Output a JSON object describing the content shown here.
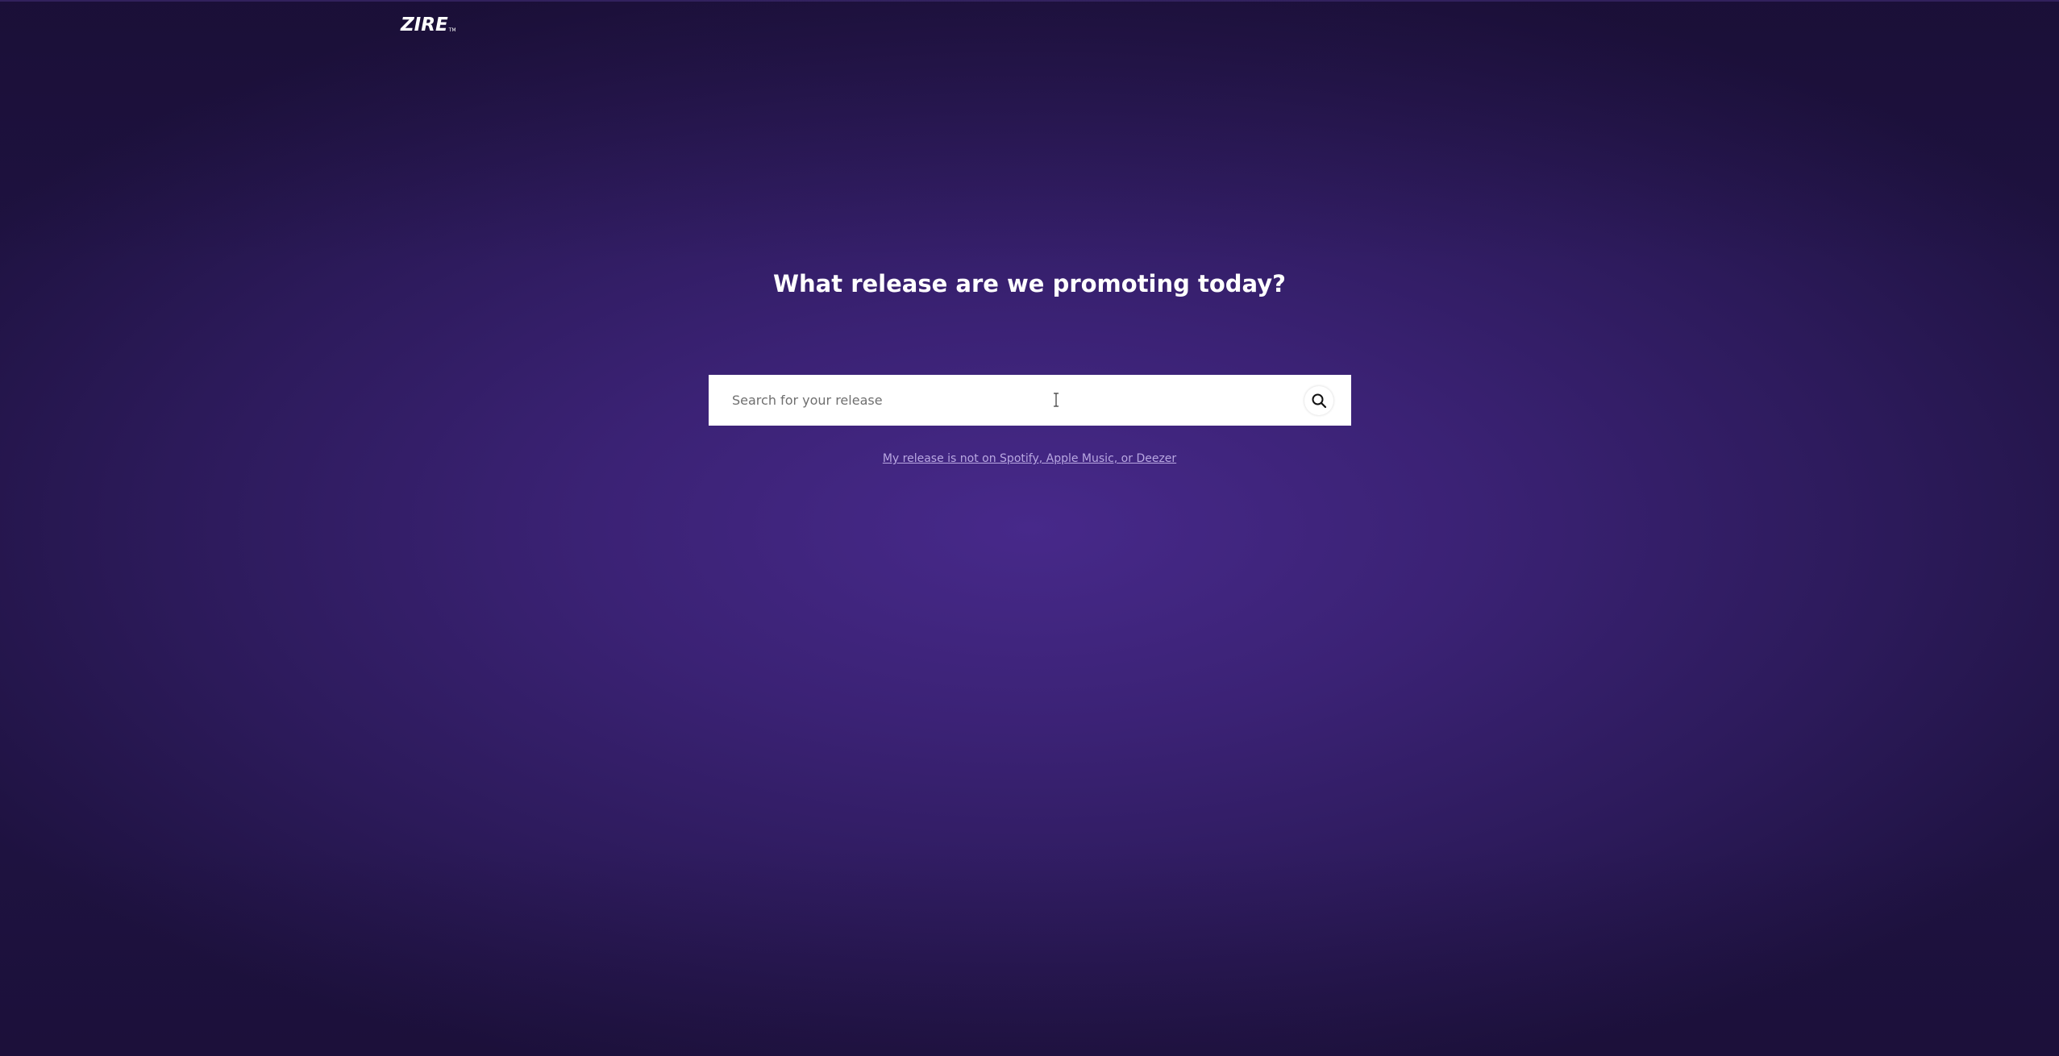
{
  "header": {
    "logo_text": "ZIRE",
    "logo_tm": "TM"
  },
  "hero": {
    "headline": "What release are we promoting today?"
  },
  "search": {
    "placeholder": "Search for your release",
    "value": ""
  },
  "links": {
    "not_on_platforms": "My release is not on Spotify, Apple Music, or Deezer"
  },
  "icons": {
    "search": "search-icon",
    "cursor": "text-cursor-icon"
  },
  "colors": {
    "background": "#3b2275",
    "headline": "#ffffff",
    "link": "#b9a8e2",
    "search_bg": "#ffffff"
  }
}
